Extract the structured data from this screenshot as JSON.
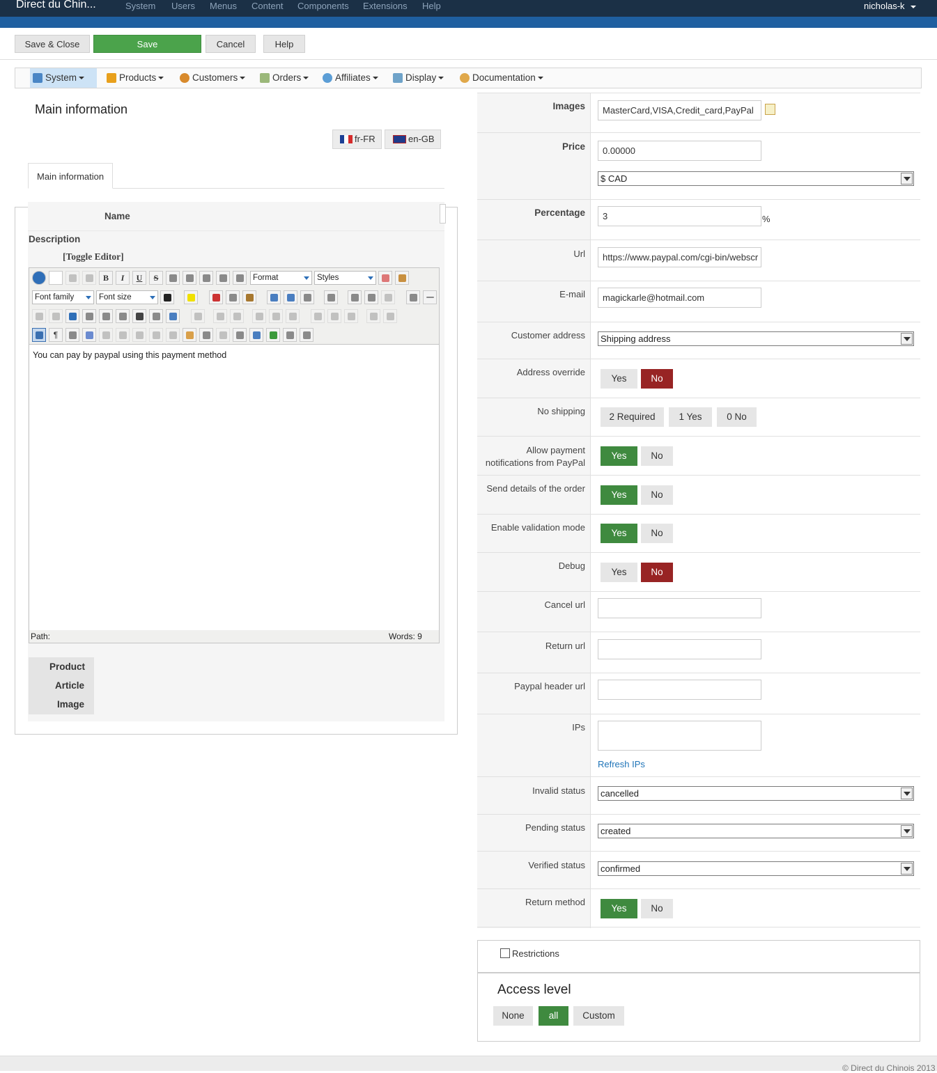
{
  "topbar": {
    "brand": "Direct du Chin...",
    "menu": [
      "System",
      "Users",
      "Menus",
      "Content",
      "Components",
      "Extensions",
      "Help"
    ],
    "user": "nicholas-k"
  },
  "toolbar": {
    "save_close": "Save & Close",
    "save": "Save",
    "cancel": "Cancel",
    "help": "Help"
  },
  "nav": [
    "System",
    "Products",
    "Customers",
    "Orders",
    "Affiliates",
    "Display",
    "Documentation"
  ],
  "left": {
    "section_title": "Main information",
    "lang_fr": "fr-FR",
    "lang_en": "en-GB",
    "tab_main": "Main information",
    "name_label": "Name",
    "description_label": "Description",
    "toggle_editor": "[Toggle Editor]",
    "editor": {
      "format": "Format",
      "styles": "Styles",
      "font_family": "Font family",
      "font_size": "Font size",
      "content": "You can pay by paypal using this payment method",
      "path": "Path:",
      "words": "Words: 9"
    },
    "insert_buttons": [
      "Product",
      "Article",
      "Image"
    ]
  },
  "right": {
    "images_label": "Images",
    "images_value": "MasterCard,VISA,Credit_card,PayPal",
    "price_label": "Price",
    "price_value": "0.00000",
    "currency": "$ CAD",
    "percentage_label": "Percentage",
    "percentage_value": "3",
    "percent_sign": "%",
    "url_label": "Url",
    "url_value": "https://www.paypal.com/cgi-bin/webscr",
    "email_label": "E-mail",
    "email_value": "magickarle@hotmail.com",
    "customer_address_label": "Customer address",
    "customer_address_value": "Shipping address",
    "address_override_label": "Address override",
    "no_shipping_label": "No shipping",
    "no_shipping_opts": [
      "2 Required",
      "1 Yes",
      "0 No"
    ],
    "allow_notif_label1": "Allow payment",
    "allow_notif_label2": "notifications from PayPal",
    "send_details_label": "Send details of the order",
    "validation_label": "Enable validation mode",
    "debug_label": "Debug",
    "cancel_url_label": "Cancel url",
    "return_url_label": "Return url",
    "header_url_label": "Paypal header url",
    "ips_label": "IPs",
    "refresh_ips": "Refresh IPs",
    "invalid_status_label": "Invalid status",
    "invalid_status_value": "cancelled",
    "pending_status_label": "Pending status",
    "pending_status_value": "created",
    "verified_status_label": "Verified status",
    "verified_status_value": "confirmed",
    "return_method_label": "Return method",
    "yes": "Yes",
    "no": "No"
  },
  "restrictions": {
    "label": "Restrictions"
  },
  "access": {
    "title": "Access level",
    "none": "None",
    "all": "all",
    "custom": "Custom"
  },
  "footer": {
    "copyright": "© Direct du Chinois 2013"
  },
  "colors": {
    "top_bar": "#1b3046",
    "green": "#4ba34b",
    "red": "#982424"
  }
}
